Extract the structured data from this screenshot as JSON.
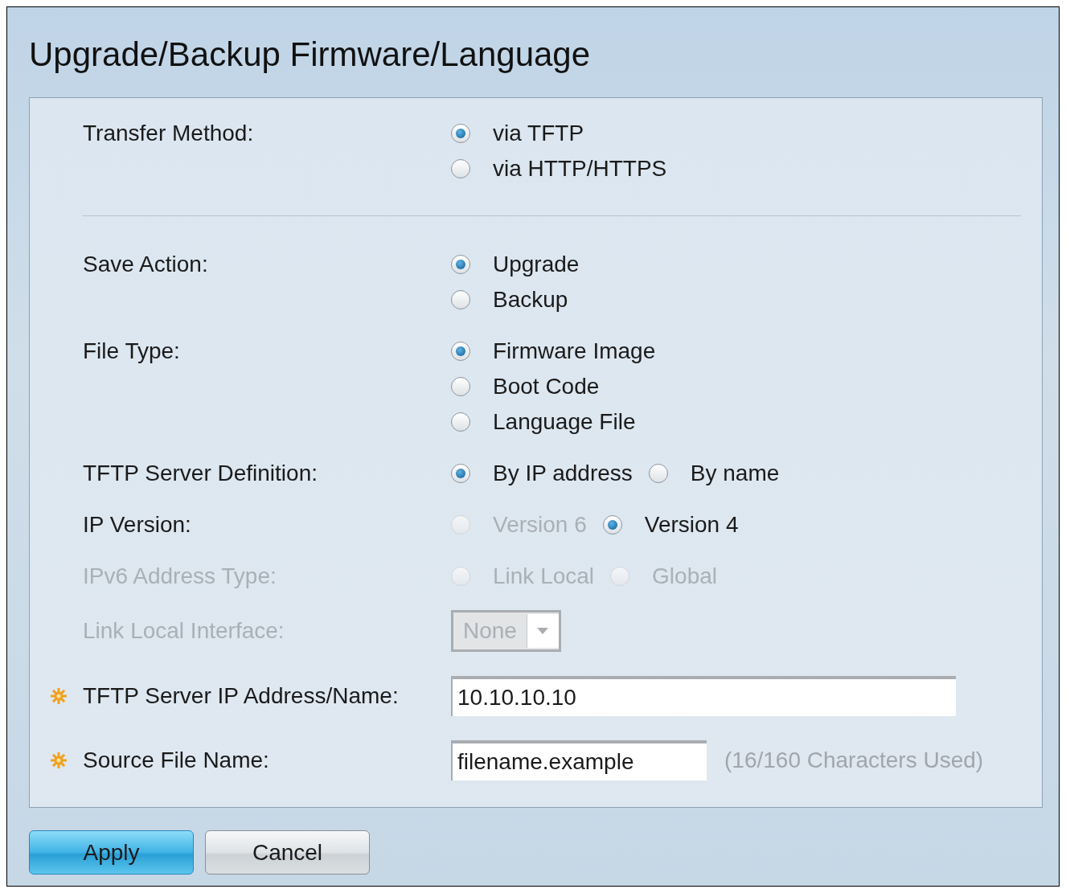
{
  "title": "Upgrade/Backup Firmware/Language",
  "sections": [
    {
      "fields": [
        {
          "label": "Transfer Method:",
          "kind": "radio_list",
          "disabled": false,
          "options": [
            {
              "label": "via TFTP",
              "selected": true,
              "disabled": false
            },
            {
              "label": "via HTTP/HTTPS",
              "selected": false,
              "disabled": false
            }
          ]
        }
      ]
    },
    {
      "fields": [
        {
          "label": "Save Action:",
          "kind": "radio_list",
          "disabled": false,
          "options": [
            {
              "label": "Upgrade",
              "selected": true,
              "disabled": false
            },
            {
              "label": "Backup",
              "selected": false,
              "disabled": false
            }
          ]
        },
        {
          "label": "File Type:",
          "kind": "radio_list",
          "disabled": false,
          "options": [
            {
              "label": "Firmware Image",
              "selected": true,
              "disabled": false
            },
            {
              "label": "Boot Code",
              "selected": false,
              "disabled": false
            },
            {
              "label": "Language File",
              "selected": false,
              "disabled": false
            }
          ]
        },
        {
          "label": "TFTP Server Definition:",
          "kind": "radio_row",
          "disabled": false,
          "options": [
            {
              "label": "By IP address",
              "selected": true,
              "disabled": false
            },
            {
              "label": "By name",
              "selected": false,
              "disabled": false
            }
          ]
        },
        {
          "label": "IP Version:",
          "kind": "radio_row",
          "disabled": false,
          "options": [
            {
              "label": "Version 6",
              "selected": false,
              "disabled": true
            },
            {
              "label": "Version 4",
              "selected": true,
              "disabled": false
            }
          ]
        },
        {
          "label": "IPv6 Address Type:",
          "kind": "radio_row",
          "disabled": true,
          "options": [
            {
              "label": "Link Local",
              "selected": false,
              "disabled": true
            },
            {
              "label": "Global",
              "selected": false,
              "disabled": true
            }
          ]
        },
        {
          "label": "Link Local Interface:",
          "kind": "select",
          "disabled": true,
          "value": "None"
        },
        {
          "label": "TFTP Server IP Address/Name:",
          "kind": "text",
          "required": true,
          "value": "10.10.10.10"
        },
        {
          "label": "Source File Name:",
          "kind": "text",
          "required": true,
          "value": "filename.example",
          "hint": "(16/160 Characters Used)"
        }
      ]
    }
  ],
  "buttons": [
    {
      "label": "Apply",
      "primary": true
    },
    {
      "label": "Cancel",
      "primary": false
    }
  ]
}
